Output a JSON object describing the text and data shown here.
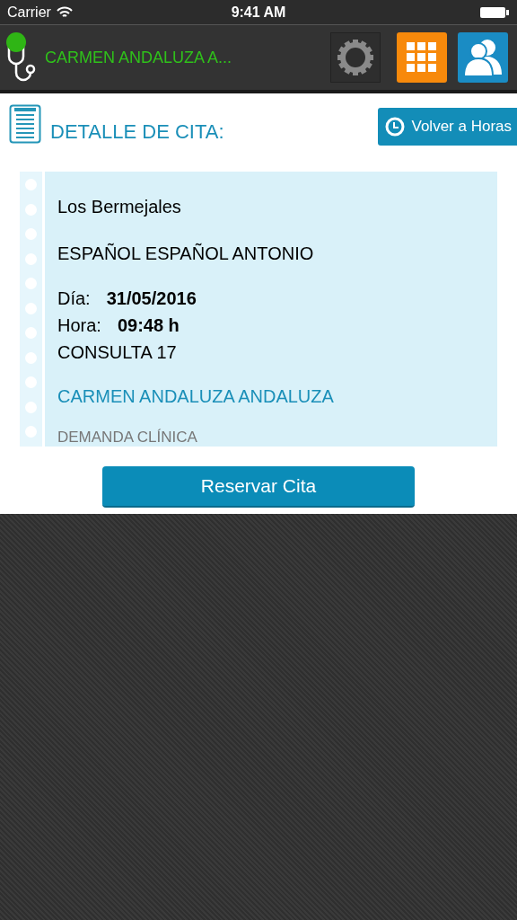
{
  "status_bar": {
    "carrier": "Carrier",
    "time": "9:41 AM"
  },
  "header": {
    "user_name": "CARMEN ANDALUZA A..."
  },
  "detail": {
    "title": "DETALLE DE CITA:",
    "back_button": "Volver a Horas"
  },
  "card": {
    "center": "Los Bermejales",
    "professional": "ESPAÑOL ESPAÑOL ANTONIO",
    "day_label": "Día:",
    "day": "31/05/2016",
    "hour_label": "Hora:",
    "hour": "09:48 h",
    "room": "CONSULTA 17",
    "patient": "CARMEN ANDALUZA ANDALUZA",
    "type": "DEMANDA CLÍNICA"
  },
  "reserve_button": "Reservar Cita"
}
